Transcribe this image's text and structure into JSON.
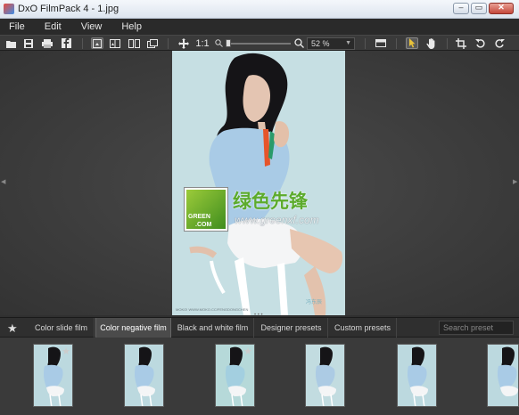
{
  "window": {
    "title": "DxO FilmPack 4 - 1.jpg"
  },
  "menu": [
    "File",
    "Edit",
    "View",
    "Help"
  ],
  "toolbar": {
    "ratio_label": "1:1",
    "zoom_value": "52 %"
  },
  "watermark": {
    "site": "www.greenxf.com",
    "cn_name": "绿色先锋",
    "logo_text_1": "GREEN",
    "logo_text_2": ".COM",
    "credit": "MOKO! WWW.MOKO.CC/FENGDONGCHEN",
    "badge": "冯东辰"
  },
  "tabs": [
    {
      "label": "Color slide film"
    },
    {
      "label": "Color negative film"
    },
    {
      "label": "Black and white film"
    },
    {
      "label": "Designer presets"
    },
    {
      "label": "Custom presets"
    }
  ],
  "search": {
    "placeholder": "Search preset"
  },
  "colors": {
    "background": "#303030",
    "accent": "#e8c23a"
  },
  "icons": [
    "open-folder-icon",
    "save-icon",
    "print-icon",
    "facebook-icon",
    "single-view-icon",
    "compare-split-icon",
    "compare-side-by-side-icon",
    "compare-original-icon",
    "move-icon",
    "zoom-out-icon",
    "zoom-in-icon",
    "fullscreen-icon",
    "pointer-icon",
    "hand-icon",
    "crop-icon",
    "rotate-left-icon",
    "rotate-right-icon",
    "star-icon"
  ]
}
